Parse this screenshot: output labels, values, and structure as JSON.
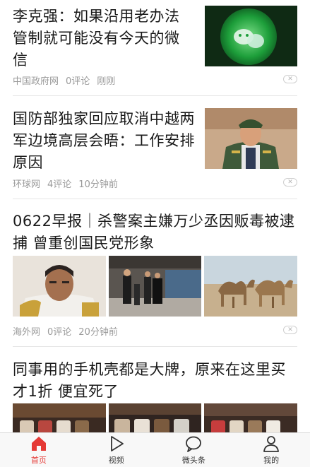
{
  "articles": [
    {
      "title": "李克强：如果沿用老办法管制就可能没有今天的微信",
      "source": "中国政府网",
      "comments": "0评论",
      "time": "刚刚",
      "image": "wechat-logo-photo"
    },
    {
      "title": "国防部独家回应取消中越两军边境高层会晤：工作安排原因",
      "source": "环球网",
      "comments": "4评论",
      "time": "10分钟前",
      "image": "military-officer-photo"
    },
    {
      "title": "0622早报｜杀警案主嫌万少丞因贩毒被逮捕 曾重创国民党形象",
      "source": "海外网",
      "comments": "0评论",
      "time": "20分钟前",
      "images": [
        "king-portrait-photo",
        "airport-police-photo",
        "camels-desert-photo"
      ]
    },
    {
      "title": "同事用的手机壳都是大牌，原来在这里买才1折 便宜死了",
      "images": [
        "phone-case-store-photo-1",
        "phone-case-store-photo-2",
        "phone-case-store-photo-3"
      ]
    }
  ],
  "tabbar": {
    "active": "home",
    "tabs": [
      {
        "id": "home",
        "label": "首页",
        "icon": "home-icon"
      },
      {
        "id": "video",
        "label": "视频",
        "icon": "play-icon"
      },
      {
        "id": "weitoutiao",
        "label": "微头条",
        "icon": "chat-bubble-icon"
      },
      {
        "id": "mine",
        "label": "我的",
        "icon": "user-icon"
      }
    ]
  },
  "colors": {
    "accent": "#e53935",
    "meta": "#9a9a9a",
    "divider": "#e6e6e6"
  }
}
